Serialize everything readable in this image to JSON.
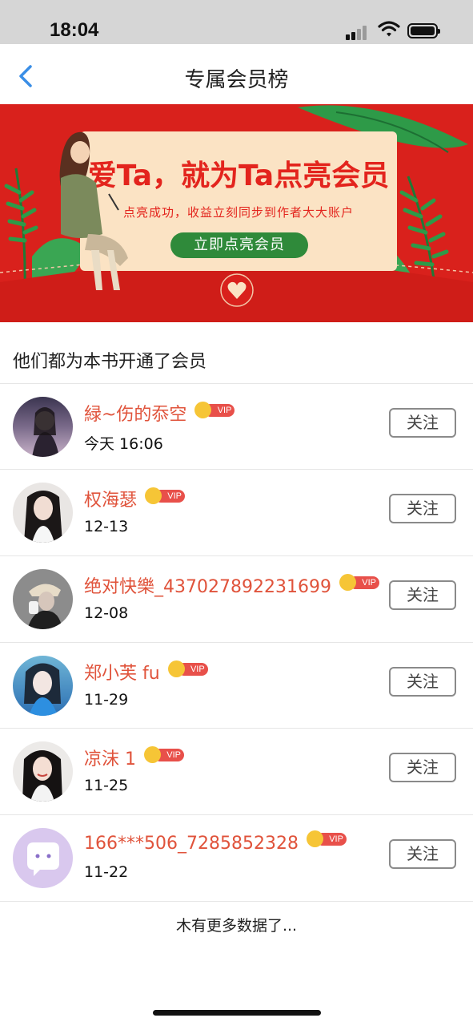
{
  "status_bar": {
    "time": "18:04"
  },
  "nav": {
    "title": "专属会员榜"
  },
  "banner": {
    "headline": "爱Ta，就为Ta点亮会员",
    "subtext": "点亮成功，收益立刻同步到作者大大账户",
    "cta": "立即点亮会员",
    "colors": {
      "background": "#d9211c",
      "card": "#fbe3c4",
      "button": "#2f8a3a"
    }
  },
  "section_title": "他们都为本书开通了会员",
  "members": [
    {
      "name": "緑~伤的忝空",
      "badge": "VIP",
      "date": "今天 16:06",
      "follow_label": "关注"
    },
    {
      "name": "权海瑟",
      "badge": "VIP",
      "date": "12-13",
      "follow_label": "关注"
    },
    {
      "name": "绝对快樂_437027892231699",
      "badge": "VIP",
      "date": "12-08",
      "follow_label": "关注"
    },
    {
      "name": "郑小芙 fu",
      "badge": "VIP",
      "date": "11-29",
      "follow_label": "关注"
    },
    {
      "name": "凉沫 1",
      "badge": "VIP",
      "date": "11-25",
      "follow_label": "关注"
    },
    {
      "name": "166***506_7285852328",
      "badge": "VIP",
      "date": "11-22",
      "follow_label": "关注"
    }
  ],
  "footer_text": "木有更多数据了...",
  "colors": {
    "username": "#e0533b",
    "vip_badge": "#e8504a",
    "crown": "#f6c536",
    "back_arrow": "#3a8ee6"
  }
}
